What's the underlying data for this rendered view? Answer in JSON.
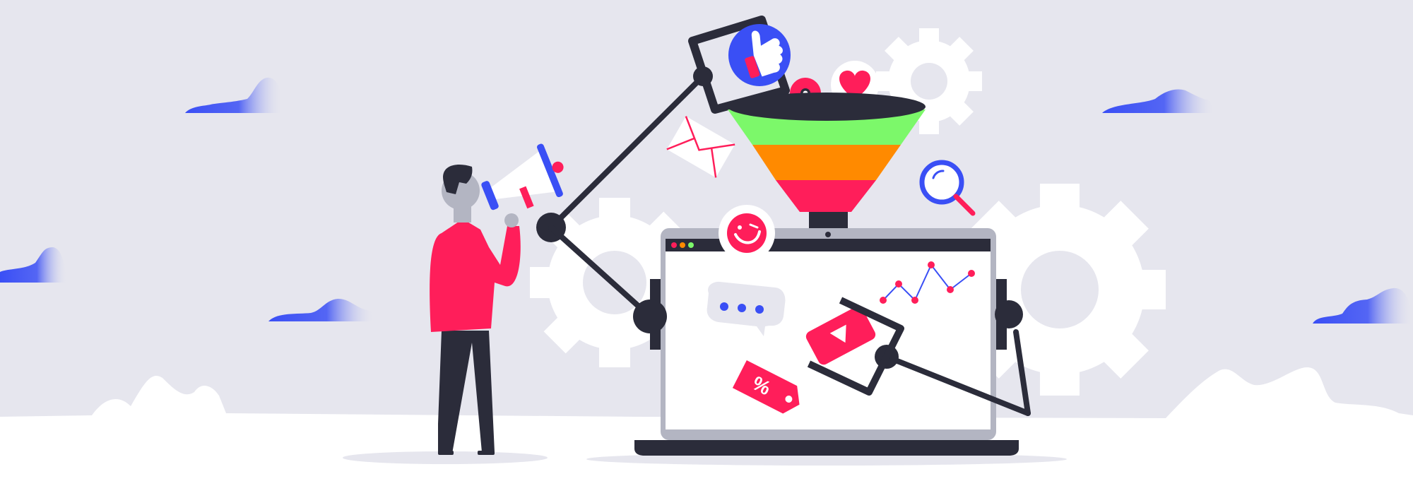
{
  "scene": {
    "kind": "marketing-funnel-illustration",
    "tag_symbol": "%",
    "browser_dots": [
      "#ff1e5a",
      "#ff8a00",
      "#7cf86a"
    ],
    "colors": {
      "background": "#e6e6ee",
      "ground": "#ffffff",
      "gear": "#ffffff",
      "accent_pink": "#ff1e5a",
      "accent_blue": "#3a4ff5",
      "dark": "#2b2c3a",
      "laptop_frame": "#b3b5c2",
      "funnel_bands": [
        "#7cf86a",
        "#ff8a00",
        "#ff1e5a"
      ]
    },
    "icons": [
      "like-icon",
      "heart-icon",
      "location-pin-icon",
      "mail-icon",
      "search-icon",
      "emoji-icon",
      "chat-bubble-icon",
      "video-play-icon",
      "discount-tag-icon",
      "line-chart-icon",
      "megaphone-icon",
      "gear-icon"
    ]
  }
}
